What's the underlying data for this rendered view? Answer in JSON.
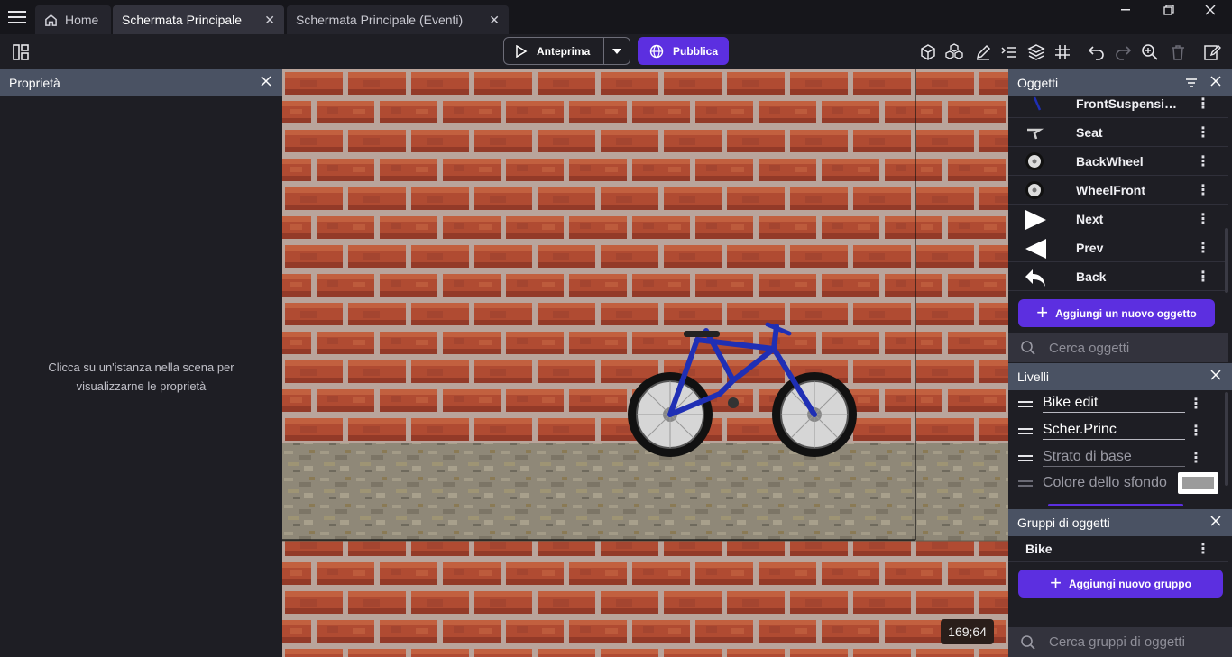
{
  "tabs": [
    {
      "label": "Home"
    },
    {
      "label": "Schermata Principale"
    },
    {
      "label": "Schermata Principale (Eventi)"
    }
  ],
  "toolbar": {
    "preview_label": "Anteprima",
    "publish_label": "Pubblica",
    "accent": "#5c2fe0"
  },
  "properties_panel": {
    "title": "Proprietà",
    "hint": "Clicca su un'istanza nella scena per visualizzarne le proprietà"
  },
  "scene": {
    "coords": "169;64"
  },
  "objects_panel": {
    "title": "Oggetti",
    "items": [
      {
        "name": "FrontSuspension...",
        "icon": "suspension-icon"
      },
      {
        "name": "Seat",
        "icon": "seat-icon"
      },
      {
        "name": "BackWheel",
        "icon": "wheel-icon"
      },
      {
        "name": "WheelFront",
        "icon": "wheel-icon"
      },
      {
        "name": "Next",
        "icon": "next-arrow-icon"
      },
      {
        "name": "Prev",
        "icon": "prev-arrow-icon"
      },
      {
        "name": "Back",
        "icon": "back-arrow-icon"
      }
    ],
    "add_label": "Aggiungi un nuovo oggetto",
    "search_placeholder": "Cerca oggetti"
  },
  "layers_panel": {
    "title": "Livelli",
    "layers": [
      {
        "name": "Bike edit"
      },
      {
        "name": "Scher.Princ"
      },
      {
        "name": "Strato di base"
      }
    ],
    "background_label": "Colore dello sfondo",
    "background_color": "#9b9b9b"
  },
  "groups_panel": {
    "title": "Gruppi di oggetti",
    "groups": [
      {
        "name": "Bike"
      }
    ],
    "add_label": "Aggiungi nuovo gruppo",
    "search_placeholder": "Cerca gruppi di oggetti"
  }
}
